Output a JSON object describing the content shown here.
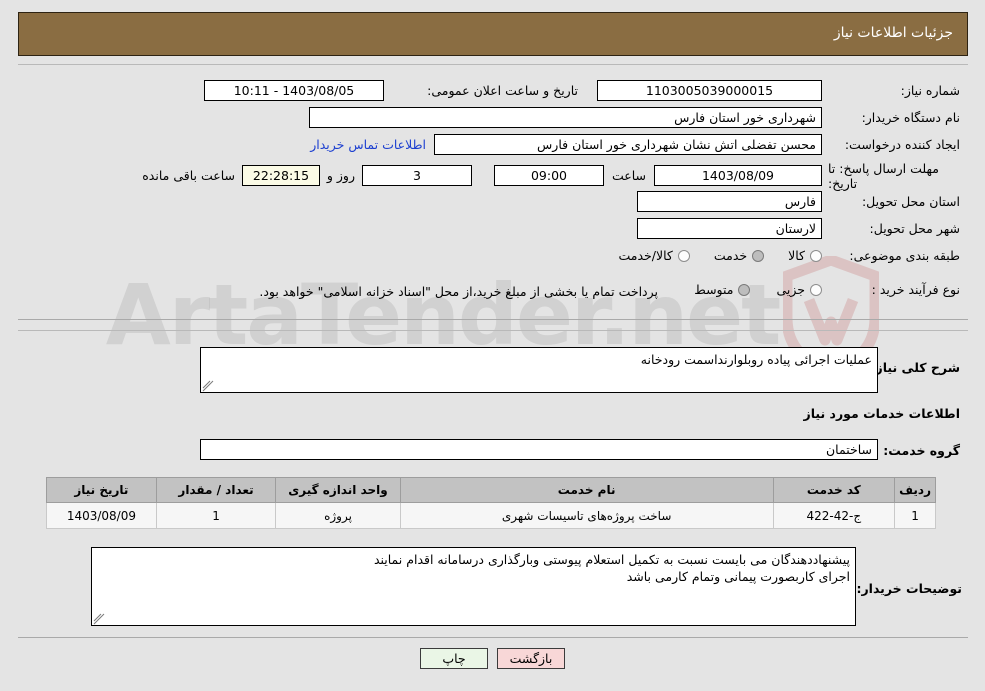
{
  "header": {
    "title": "جزئیات اطلاعات نیاز"
  },
  "watermark": {
    "text": "ArtaTender.net",
    "icon": "shield-icon"
  },
  "top_form": {
    "need_number": {
      "label": "شماره نیاز:",
      "value": "1103005039000015"
    },
    "announce_datetime": {
      "label": "تاریخ و ساعت اعلان عمومی:",
      "value": "1403/08/05 - 10:11"
    },
    "buyer_org": {
      "label": "نام دستگاه خریدار:",
      "value": "شهرداری خور استان فارس"
    },
    "requester": {
      "label": "ایجاد کننده درخواست:",
      "value": "محسن  تفضلی  اتش نشان  شهرداری خور استان فارس"
    },
    "contact_link": {
      "label": "اطلاعات تماس خریدار"
    },
    "deadline": {
      "label_line1": "مهلت ارسال پاسخ: تا",
      "label_line2": "تاریخ:",
      "date": "1403/08/09",
      "hour_label": "ساعت",
      "hour": "09:00",
      "days": "3",
      "days_unit": "روز و",
      "countdown": "22:28:15",
      "countdown_suffix": "ساعت باقی مانده"
    },
    "delivery_province": {
      "label": "استان محل تحویل:",
      "value": "فارس"
    },
    "delivery_city": {
      "label": "شهر محل تحویل:",
      "value": "لارستان"
    },
    "category": {
      "label": "طبقه بندی موضوعی:",
      "options": [
        {
          "label": "کالا",
          "selected": false
        },
        {
          "label": "خدمت",
          "selected": true
        },
        {
          "label": "کالا/خدمت",
          "selected": false
        }
      ]
    },
    "purchase_type": {
      "label": "نوع فرآیند خرید :",
      "options": [
        {
          "label": "جزیی",
          "selected": false
        },
        {
          "label": "متوسط",
          "selected": true
        }
      ],
      "note": "پرداخت تمام یا بخشی از مبلغ خرید،از محل \"اسناد خزانه اسلامی\" خواهد بود."
    }
  },
  "mid_form": {
    "general_desc": {
      "label": "شرح کلی نیاز:",
      "value": "عملیات اجرائی پیاده روبلوارنداسمت رودخانه"
    },
    "services_section_title": "اطلاعات خدمات مورد نیاز",
    "service_group": {
      "label": "گروه خدمت:",
      "value": "ساختمان"
    }
  },
  "services_table": {
    "columns": [
      "ردیف",
      "کد خدمت",
      "نام خدمت",
      "واحد اندازه گیری",
      "تعداد / مقدار",
      "تاریخ نیاز"
    ],
    "rows": [
      {
        "row_no": "1",
        "service_code": "ج-42-422",
        "service_name": "ساخت پروژه‌های تاسیسات شهری",
        "unit": "پروژه",
        "quantity": "1",
        "need_date": "1403/08/09"
      }
    ]
  },
  "buyer_notes": {
    "label": "توضیحات خریدار:",
    "value": "پیشنهاددهندگان می بایست نسبت به تکمیل استعلام پیوستی وبارگذاری درسامانه اقدام نمایند\nاجرای کاربصورت پیمانی وتمام کارمی باشد"
  },
  "footer": {
    "back_button": "بازگشت",
    "print_button": "چاپ"
  },
  "colors": {
    "header_bg": "#8a6d42",
    "page_bg": "#e4e4e4",
    "link": "#1c3fd0",
    "back_button_bg": "#f8d7d7",
    "print_button_bg": "#eaf6e6",
    "table_header_bg": "#c2c2c2"
  }
}
